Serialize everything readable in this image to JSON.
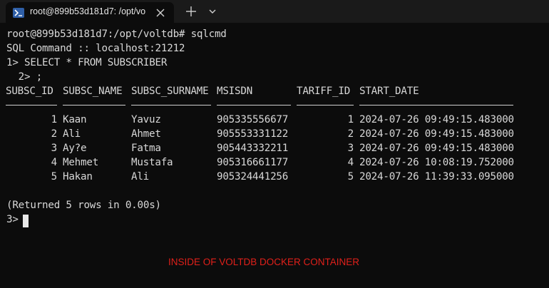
{
  "window": {
    "tab_title": "root@899b53d181d7: /opt/vo",
    "icons": {
      "tab": "powershell-icon",
      "close": "close-icon",
      "new_tab": "plus-icon",
      "dropdown": "chevron-down-icon"
    }
  },
  "terminal": {
    "lines": [
      "root@899b53d181d7:/opt/voltdb# sqlcmd",
      "SQL Command :: localhost:21212",
      "1> SELECT * FROM SUBSCRIBER",
      "  2> ;"
    ],
    "columns": [
      "SUBSC_ID",
      "SUBSC_NAME",
      "SUBSC_SURNAME",
      "MSISDN",
      "TARIFF_ID",
      "START_DATE"
    ],
    "rows": [
      [
        "1",
        "Kaan",
        "Yavuz",
        "905335556677",
        "1",
        "2024-07-26 09:49:15.483000"
      ],
      [
        "2",
        "Ali",
        "Ahmet",
        "905553331122",
        "2",
        "2024-07-26 09:49:15.483000"
      ],
      [
        "3",
        "Ay?e",
        "Fatma",
        "905443332211",
        "3",
        "2024-07-26 09:49:15.483000"
      ],
      [
        "4",
        "Mehmet",
        "Mustafa",
        "905316661177",
        "4",
        "2024-07-26 10:08:19.752000"
      ],
      [
        "5",
        "Hakan",
        "Ali",
        "905324441256",
        "5",
        "2024-07-26 11:39:33.095000"
      ]
    ],
    "result_summary": "(Returned 5 rows in 0.00s)",
    "prompt": "3>"
  },
  "caption": {
    "text": "INSIDE OF VOLTDB DOCKER CONTAINER",
    "color": "#e0201a"
  }
}
